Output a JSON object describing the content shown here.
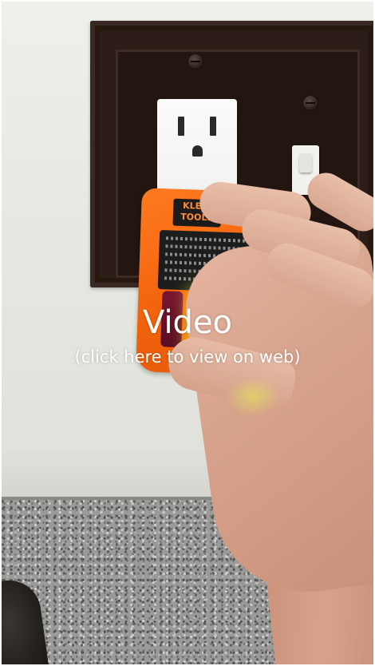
{
  "video": {
    "title": "Video",
    "subtitle": "(click here to view on web)",
    "icon": "video-thumbnail-image"
  },
  "device": {
    "brand_line1": "KLEIN",
    "brand_line2": "TOOLS"
  },
  "colors": {
    "tester_orange": "#f3630d",
    "light_red": "#7a1530",
    "light_yellow": "#e4f01c",
    "wall_plate": "#2c1d18",
    "overlay_text": "#ffffff"
  }
}
